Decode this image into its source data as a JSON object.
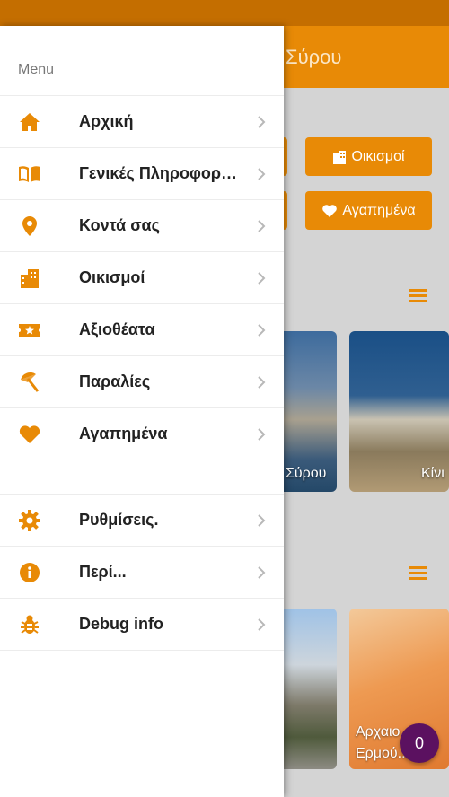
{
  "colors": {
    "accent": "#e88a06",
    "status_bar": "#c46e00",
    "fab": "#5b1160"
  },
  "background": {
    "title_partial": "Σύρου",
    "buttons": [
      {
        "label": "Οικισμοί",
        "icon": "buildings-icon"
      },
      {
        "label": "Αγαπημένα",
        "icon": "heart-icon"
      }
    ],
    "cards": [
      {
        "caption": "Σύρου"
      },
      {
        "caption": "Κίνι"
      },
      {
        "caption": "Αρχαιο...ό\nΕρμού...ς"
      }
    ],
    "fab_count": "0"
  },
  "drawer": {
    "menu_label": "Menu",
    "items": [
      {
        "label": "Αρχική",
        "icon": "home-icon"
      },
      {
        "label": "Γενικές Πληροφορίες",
        "icon": "book-icon"
      },
      {
        "label": "Κοντά σας",
        "icon": "map-pin-icon"
      },
      {
        "label": "Οικισμοί",
        "icon": "buildings-icon"
      },
      {
        "label": "Αξιοθέατα",
        "icon": "ticket-star-icon"
      },
      {
        "label": "Παραλίες",
        "icon": "beach-umbrella-icon"
      },
      {
        "label": "Αγαπημένα",
        "icon": "heart-icon"
      }
    ],
    "secondary_items": [
      {
        "label": "Ρυθμίσεις.",
        "icon": "gear-icon"
      },
      {
        "label": "Περί...",
        "icon": "info-icon"
      },
      {
        "label": "Debug info",
        "icon": "bug-icon"
      }
    ]
  }
}
